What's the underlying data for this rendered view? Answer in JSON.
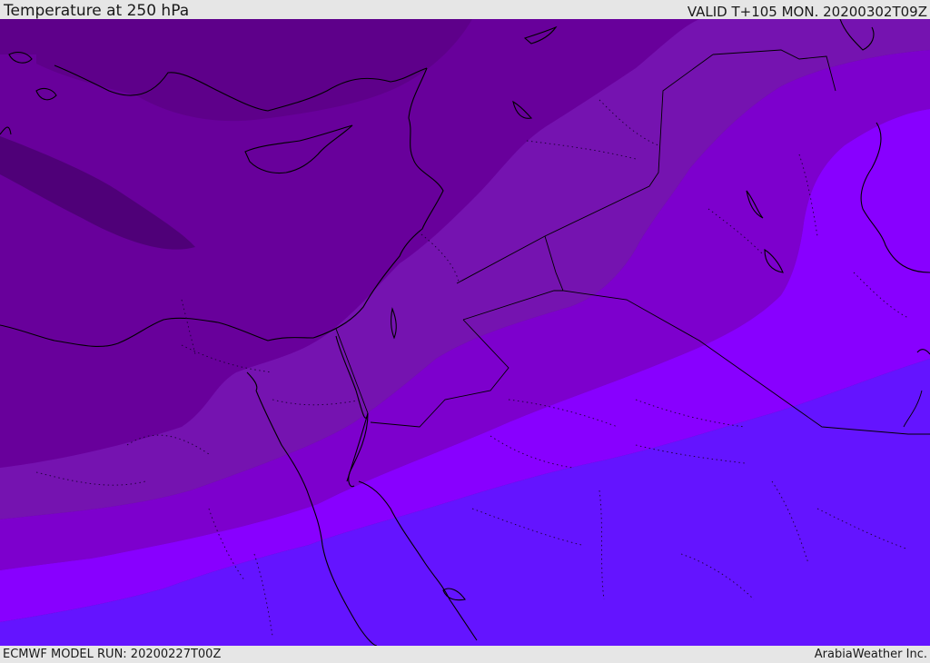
{
  "header": {
    "title": "Temperature at 250 hPa",
    "valid": "VALID T+105 MON. 20200302T09Z"
  },
  "footer": {
    "model_run": "ECMWF MODEL RUN: 20200227T00Z",
    "credit": "ArabiaWeather Inc."
  },
  "colors": {
    "band_1": "#4f0078",
    "band_2": "#5e008a",
    "band_3": "#68009b",
    "band_4": "#7513b0",
    "band_5": "#7d00cd",
    "band_6": "#8800ff",
    "band_7": "#6414ff",
    "coastline": "#000000"
  }
}
